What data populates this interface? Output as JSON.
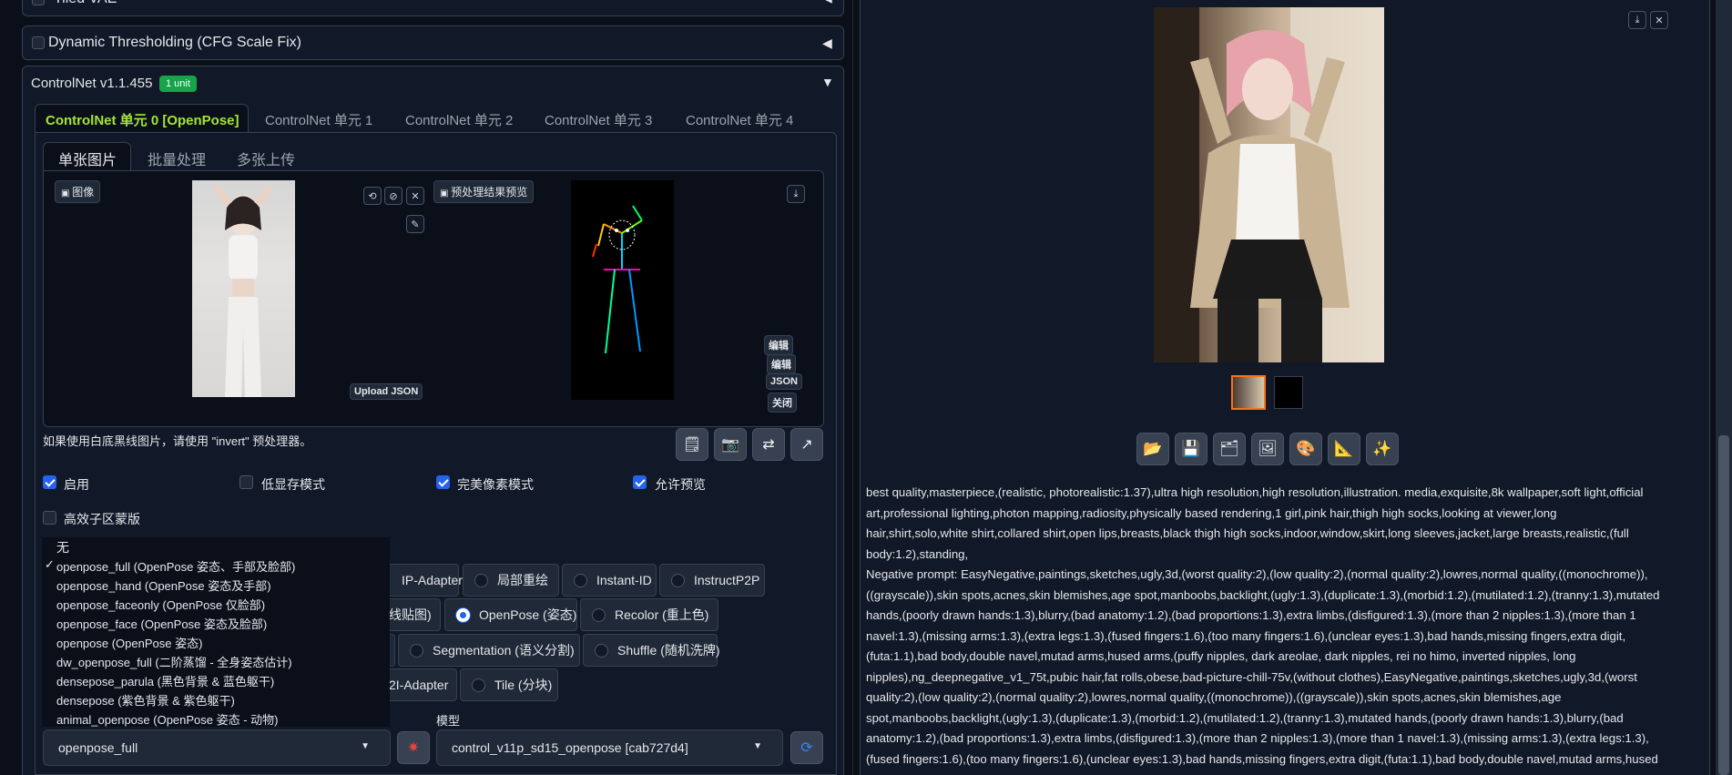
{
  "accordions": {
    "tiled_vae": "Tiled VAE",
    "dynamic_threshold": "Dynamic Thresholding (CFG Scale Fix)",
    "controlnet_title": "ControlNet v1.1.455",
    "controlnet_badge": "1 unit"
  },
  "unit_tabs": [
    "ControlNet 单元 0 [OpenPose]",
    "ControlNet 单元 1",
    "ControlNet 单元 2",
    "ControlNet 单元 3",
    "ControlNet 单元 4"
  ],
  "input_tabs": [
    "单张图片",
    "批量处理",
    "多张上传"
  ],
  "image_panel": {
    "image_label": "图像",
    "preview_label": "预处理结果预览",
    "upload_json": "Upload JSON",
    "edit1": "编辑",
    "edit2": "编辑",
    "json": "JSON",
    "close": "关闭"
  },
  "hint": "如果使用白底黑线图片，请使用 \"invert\" 预处理器。",
  "checkboxes": {
    "enable": "启用",
    "low_vram": "低显存模式",
    "pixel_perfect": "完美像素模式",
    "allow_preview": "允许预览",
    "effective_region": "高效子区蒙版"
  },
  "preprocessor_options": [
    "无",
    "openpose_full (OpenPose 姿态、手部及脸部)",
    "openpose_hand (OpenPose 姿态及手部)",
    "openpose_faceonly (OpenPose 仅脸部)",
    "openpose_face (OpenPose 姿态及脸部)",
    "openpose (OpenPose 姿态)",
    "dw_openpose_full (二阶蒸馏 - 全身姿态估计)",
    "densepose_parula (黑色背景 & 蓝色躯干)",
    "densepose (紫色背景 & 紫色躯干)",
    "animal_openpose (OpenPose 姿态 - 动物)"
  ],
  "control_types": {
    "ip_adapter": "IP-Adapter",
    "inpaint": "局部重绘",
    "instant_id": "Instant-ID",
    "instruct_p2p": "InstructP2P",
    "lineart": "线贴图)",
    "openpose": "OpenPose (姿态)",
    "recolor": "Recolor (重上色)",
    "segmentation": "Segmentation (语义分割)",
    "shuffle": "Shuffle (随机洗牌)",
    "t2i_adapter": "2I-Adapter",
    "tile": "Tile (分块)"
  },
  "model_label": "模型",
  "preprocessor_value": "openpose_full",
  "model_value": "control_v11p_sd15_openpose [cab727d4]",
  "prompt": "best quality,masterpiece,(realistic, photorealistic:1.37),ultra high resolution,high resolution,illustration. media,exquisite,8k wallpaper,soft light,official art,professional lighting,photon mapping,radiosity,physically based rendering,1 girl,pink hair,thigh high socks,looking at viewer,long hair,shirt,solo,white shirt,collared shirt,open lips,breasts,black thigh high socks,indoor,window,skirt,long sleeves,jacket,large breasts,realistic,(full body:1.2),standing,",
  "negative_prompt": "Negative prompt: EasyNegative,paintings,sketches,ugly,3d,(worst quality:2),(low quality:2),(normal quality:2),lowres,normal quality,((monochrome)),((grayscale)),skin spots,acnes,skin blemishes,age spot,manboobs,backlight,(ugly:1.3),(duplicate:1.3),(morbid:1.2),(mutilated:1.2),(tranny:1.3),mutated hands,(poorly drawn hands:1.3),blurry,(bad anatomy:1.2),(bad proportions:1.3),extra limbs,(disfigured:1.3),(more than 2 nipples:1.3),(more than 1 navel:1.3),(missing arms:1.3),(extra legs:1.3),(fused fingers:1.6),(too many fingers:1.6),(unclear eyes:1.3),bad hands,missing fingers,extra digit,(futa:1.1),bad body,double navel,mutad arms,hused arms,(puffy nipples, dark areolae, dark nipples, rei no himo, inverted nipples, long nipples),ng_deepnegative_v1_75t,pubic hair,fat rolls,obese,bad-picture-chill-75v,(without clothes),EasyNegative,paintings,sketches,ugly,3d,(worst quality:2),(low quality:2),(normal quality:2),lowres,normal quality,((monochrome)),((grayscale)),skin spots,acnes,skin blemishes,age spot,manboobs,backlight,(ugly:1.3),(duplicate:1.3),(morbid:1.2),(mutilated:1.2),(tranny:1.3),mutated hands,(poorly drawn hands:1.3),blurry,(bad anatomy:1.2),(bad proportions:1.3),extra limbs,(disfigured:1.3),(more than 2 nipples:1.3),(more than 1 navel:1.3),(missing arms:1.3),(extra legs:1.3),(fused fingers:1.6),(too many fingers:1.6),(unclear eyes:1.3),bad hands,missing fingers,extra digit,(futa:1.1),bad body,double navel,mutad arms,hused"
}
